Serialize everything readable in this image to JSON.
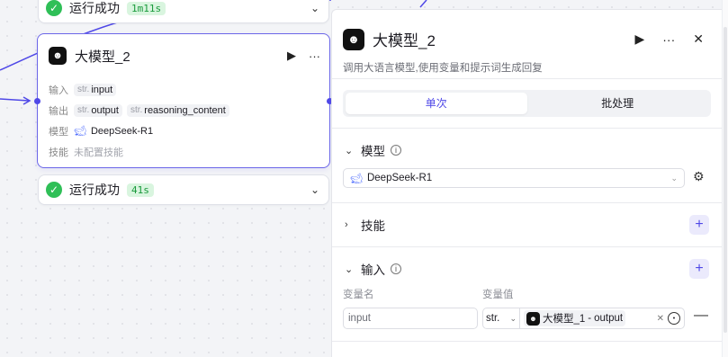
{
  "canvas": {
    "status_top": {
      "label": "运行成功",
      "duration": "1m11s"
    },
    "status_bottom": {
      "label": "运行成功",
      "duration": "41s"
    },
    "node": {
      "title": "大模型_2",
      "rows": {
        "input_key": "输入",
        "input_type": "str.",
        "input_name": "input",
        "output_key": "输出",
        "output_type1": "str.",
        "output_name1": "output",
        "output_type2": "str.",
        "output_name2": "reasoning_content",
        "model_key": "模型",
        "model_name": "DeepSeek-R1",
        "skill_key": "技能",
        "skill_value": "未配置技能"
      }
    }
  },
  "panel": {
    "title": "大模型_2",
    "description": "调用大语言模型,使用变量和提示词生成回复",
    "tabs": [
      "单次",
      "批处理"
    ],
    "active_tab": "单次",
    "model_section": {
      "label": "模型",
      "selected": "DeepSeek-R1"
    },
    "skill_section": {
      "label": "技能"
    },
    "input_section": {
      "label": "输入",
      "col_name": "变量名",
      "col_value": "变量值",
      "row": {
        "name": "input",
        "type": "str.",
        "ref_node": "大模型_1",
        "ref_sep": " - ",
        "ref_var": "output"
      }
    }
  },
  "colors": {
    "accent": "#4f48e7",
    "success": "#2fbf57",
    "success_bg": "#d9f5df"
  },
  "icons": [
    "check-circle-icon",
    "chevron-down-icon",
    "run-icon",
    "more-icon",
    "close-icon",
    "info-icon",
    "plus-icon",
    "gear-icon",
    "deepseek-icon",
    "target-icon",
    "minus-icon"
  ]
}
